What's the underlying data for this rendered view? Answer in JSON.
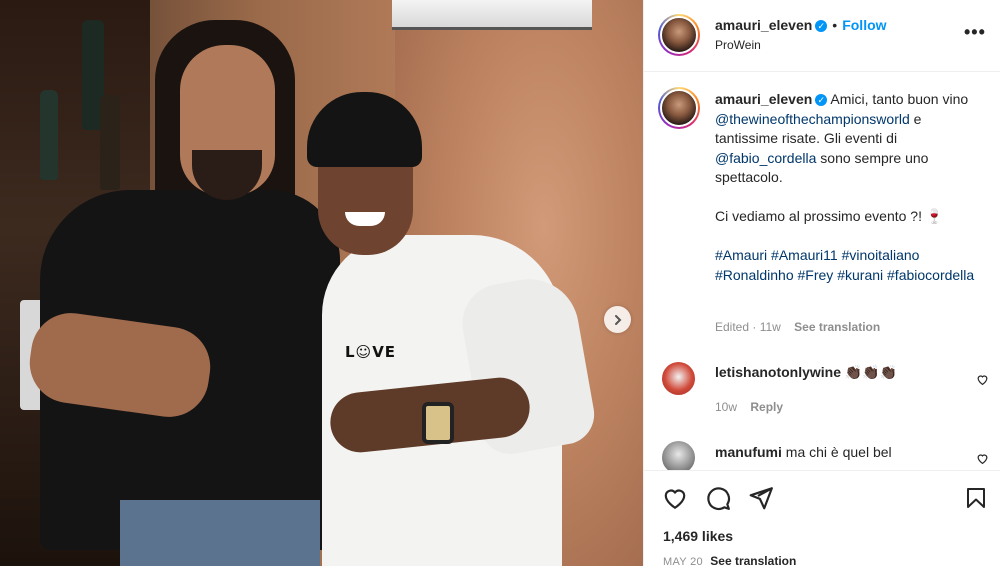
{
  "post": {
    "username": "amauri_eleven",
    "follow_label": "Follow",
    "location": "ProWein",
    "more_label": "•••",
    "next_label": "›"
  },
  "caption": {
    "username": "amauri_eleven",
    "text_1": "Amici, tanto buon vino",
    "mention_1": "@thewineofthechampionsworld",
    "text_2": "e tantissime risate. Gli eventi di",
    "mention_2": "@fabio_cordella",
    "text_3": "sono sempre uno spettacolo.",
    "text_4": "Ci vediamo al prossimo evento ?! 🍷",
    "hashtags": [
      "#Amauri",
      "#Amauri11",
      "#vinoitaliano",
      "#Ronaldinho",
      "#Frey",
      "#kurani",
      "#fabiocordella"
    ],
    "edited": "Edited · 11w",
    "see_translation": "See translation"
  },
  "comments": [
    {
      "username": "letishanotonlywine",
      "text": "👏🏿👏🏿👏🏿",
      "age": "10w",
      "reply_label": "Reply"
    },
    {
      "username": "manufumi",
      "text": "ma chi è quel bel"
    }
  ],
  "photo": {
    "shirt_text": "L☺VE"
  },
  "footer": {
    "likes": "1,469 likes",
    "date": "MAY 20",
    "see_translation": "See translation"
  }
}
